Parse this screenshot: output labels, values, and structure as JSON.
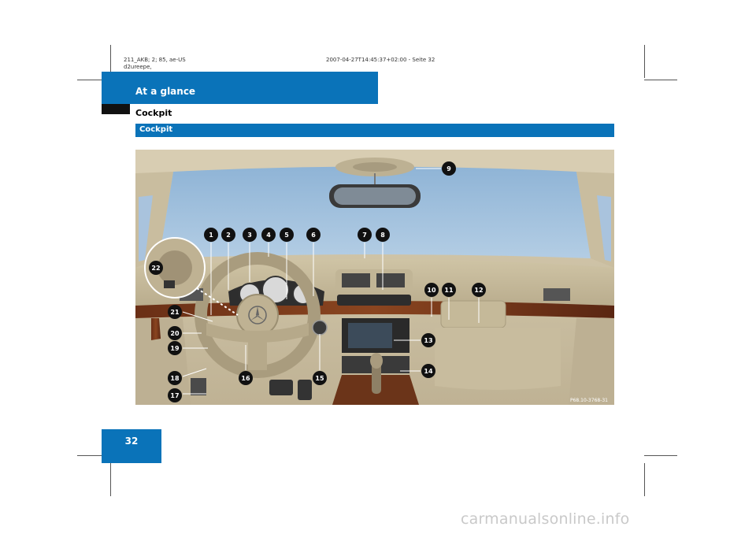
{
  "print_meta": {
    "left_line1": "211_AKB; 2; 85, ae-US",
    "left_line2": "d2ureepe,",
    "right_line1": "2007-04-27T14:45:37+02:00 - Seite 32"
  },
  "header": {
    "title": "At a glance"
  },
  "section": {
    "title": "Cockpit"
  },
  "subsection": {
    "title": "Cockpit"
  },
  "figure": {
    "callouts": [
      "1",
      "2",
      "3",
      "4",
      "5",
      "6",
      "7",
      "8",
      "9",
      "10",
      "11",
      "12",
      "13",
      "14",
      "15",
      "16",
      "17",
      "18",
      "19",
      "20",
      "21",
      "22"
    ],
    "image_code": "P68.10-3768-31"
  },
  "page": {
    "number": "32"
  },
  "watermark": "carmanualsonline.info",
  "colors": {
    "accent": "#0a73b9"
  }
}
